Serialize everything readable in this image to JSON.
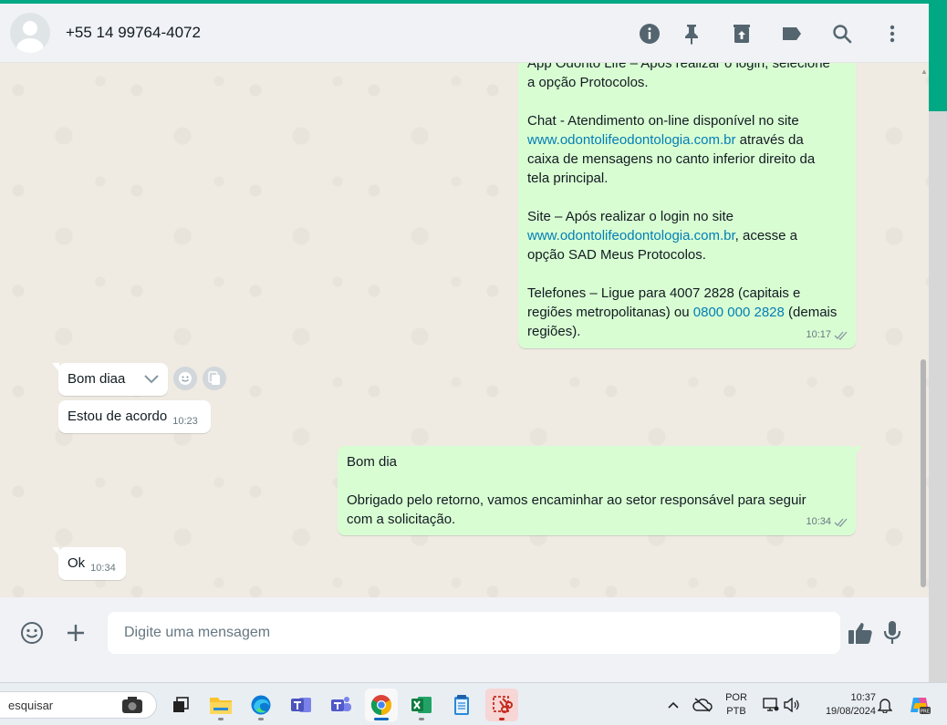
{
  "colors": {
    "brand_green": "#00a884",
    "outgoing_bubble": "#d9fdd3",
    "incoming_bubble": "#ffffff",
    "link": "#027eb5",
    "read_ticks": "#667781"
  },
  "header": {
    "contact": "+55 14 99764-4072",
    "icons": [
      "info-icon",
      "pin-icon",
      "archive-icon",
      "label-icon",
      "search-icon",
      "menu-icon"
    ]
  },
  "messages": {
    "m1": {
      "line1": "App Odonto Life – Após realizar o login, selecione",
      "line2": "a opção Protocolos.",
      "chat_prefix": "Chat - Atendimento on-line disponível no site",
      "chat_link": "www.odontolifeodontologia.com.br",
      "chat_suffix": " através da",
      "chat_line3": "caixa de mensagens no canto inferior direito da",
      "chat_line4": "tela principal.",
      "site_prefix": "Site – Após realizar o login no site",
      "site_link": "www.odontolifeodontologia.com.br",
      "site_suffix": ", acesse a",
      "site_line3": "opção SAD Meus Protocolos.",
      "phone_line1": "Telefones – Ligue para 4007 2828 (capitais e",
      "phone_prefix": "regiões metropolitanas) ou ",
      "phone_link": "0800 000 2828",
      "phone_suffix": " (demais",
      "phone_line3": "regiões).",
      "time": "10:17"
    },
    "m2": {
      "text": "Bom diaa"
    },
    "m3": {
      "text": "Estou de acordo",
      "time": "10:23"
    },
    "m4": {
      "line1": "Bom dia",
      "line2": "Obrigado pelo retorno, vamos encaminhar ao setor responsável para seguir",
      "line3": "com a solicitação.",
      "time": "10:34"
    },
    "m5": {
      "text": "Ok",
      "time": "10:34"
    }
  },
  "composer": {
    "placeholder": "Digite uma mensagem",
    "icons": [
      "emoji-icon",
      "attach-plus-icon",
      "thumbs-up-icon",
      "microphone-icon"
    ]
  },
  "taskbar": {
    "search_text": "esquisar",
    "apps": [
      "file-explorer",
      "edge",
      "teams-classic",
      "teams",
      "chrome",
      "excel",
      "notepad",
      "snipping-tool"
    ],
    "lang_line1": "POR",
    "lang_line2": "PTB",
    "time": "10:37",
    "date": "19/08/2024"
  }
}
